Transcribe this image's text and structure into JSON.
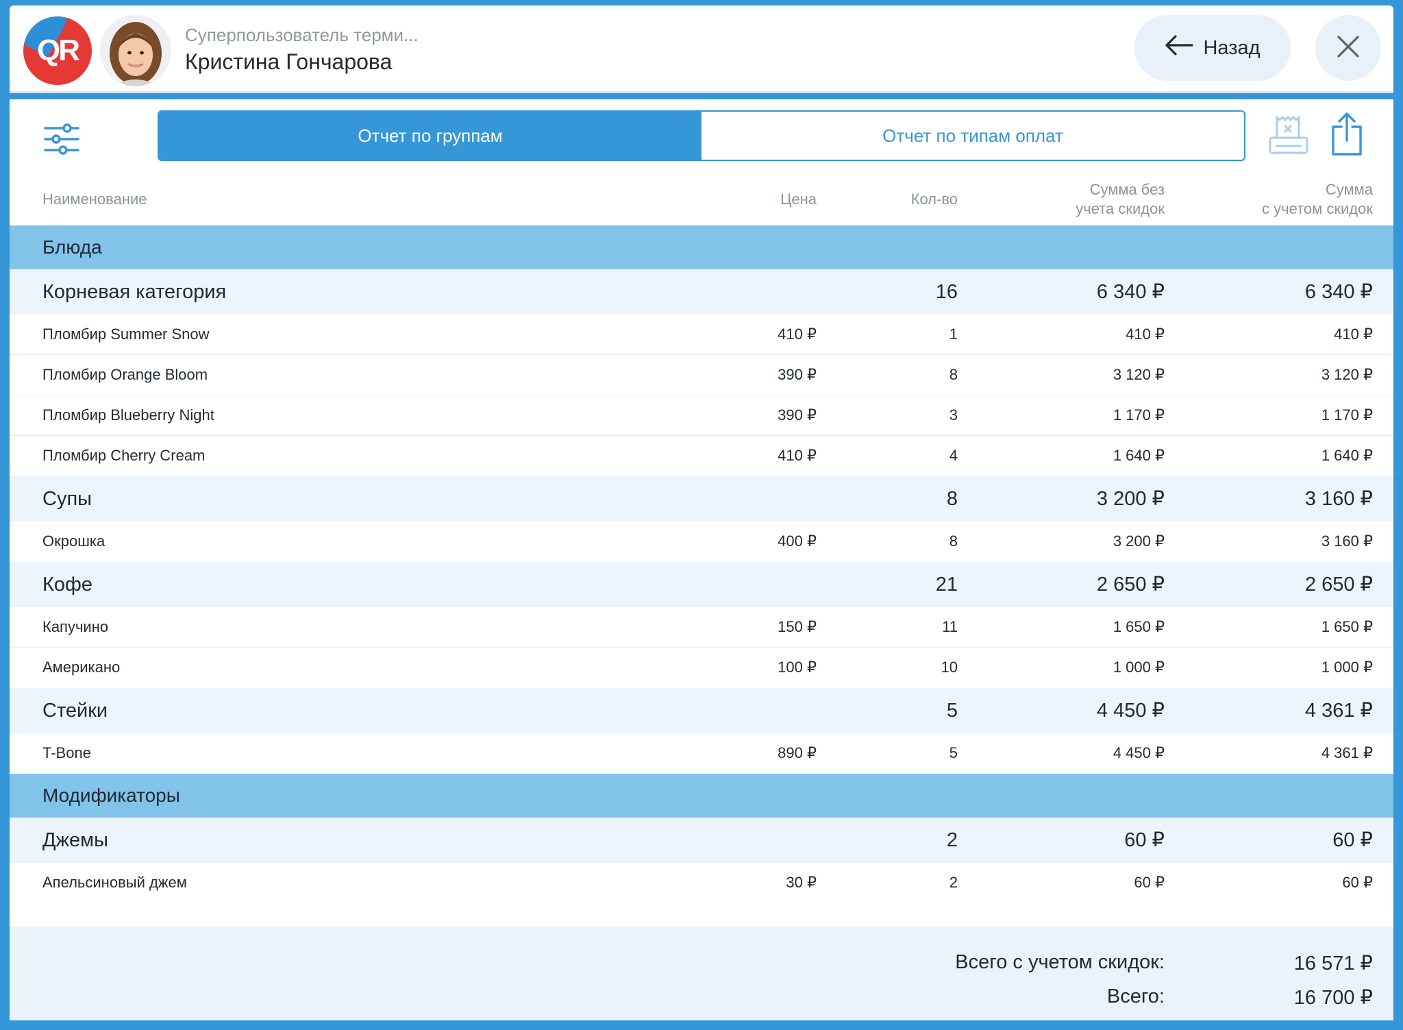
{
  "header": {
    "logo_text": "QR",
    "user_role": "Суперпользователь терми...",
    "user_name": "Кристина Гончарова",
    "back_label": "Назад"
  },
  "tabs": [
    {
      "label": "Отчет по группам",
      "active": true
    },
    {
      "label": "Отчет по типам оплат",
      "active": false
    }
  ],
  "columns": {
    "name": "Наименование",
    "price": "Цена",
    "qty": "Кол-во",
    "sum_line1": "Сумма без",
    "sum_line2": "учета скидок",
    "disc_line1": "Сумма",
    "disc_line2": "с учетом скидок"
  },
  "rows": [
    {
      "type": "section",
      "name": "Блюда"
    },
    {
      "type": "group",
      "name": "Корневая категория",
      "qty": "16",
      "sum": "6 340 ₽",
      "disc": "6 340 ₽"
    },
    {
      "type": "item",
      "name": "Пломбир Summer Snow",
      "price": "410 ₽",
      "qty": "1",
      "sum": "410 ₽",
      "disc": "410 ₽"
    },
    {
      "type": "item",
      "name": "Пломбир Orange Bloom",
      "price": "390 ₽",
      "qty": "8",
      "sum": "3 120 ₽",
      "disc": "3 120 ₽"
    },
    {
      "type": "item",
      "name": "Пломбир Blueberry Night",
      "price": "390 ₽",
      "qty": "3",
      "sum": "1 170 ₽",
      "disc": "1 170 ₽"
    },
    {
      "type": "item",
      "name": "Пломбир Cherry Cream",
      "price": "410 ₽",
      "qty": "4",
      "sum": "1 640 ₽",
      "disc": "1 640 ₽"
    },
    {
      "type": "group",
      "name": "Супы",
      "qty": "8",
      "sum": "3 200 ₽",
      "disc": "3 160 ₽"
    },
    {
      "type": "item",
      "name": "Окрошка",
      "price": "400 ₽",
      "qty": "8",
      "sum": "3 200 ₽",
      "disc": "3 160 ₽"
    },
    {
      "type": "group",
      "name": "Кофе",
      "qty": "21",
      "sum": "2 650 ₽",
      "disc": "2 650 ₽"
    },
    {
      "type": "item",
      "name": "Капучино",
      "price": "150 ₽",
      "qty": "11",
      "sum": "1 650 ₽",
      "disc": "1 650 ₽"
    },
    {
      "type": "item",
      "name": "Американо",
      "price": "100 ₽",
      "qty": "10",
      "sum": "1 000 ₽",
      "disc": "1 000 ₽"
    },
    {
      "type": "group",
      "name": "Стейки",
      "qty": "5",
      "sum": "4 450 ₽",
      "disc": "4 361 ₽"
    },
    {
      "type": "item",
      "name": "T-Bone",
      "price": "890 ₽",
      "qty": "5",
      "sum": "4 450 ₽",
      "disc": "4 361 ₽"
    },
    {
      "type": "section",
      "name": "Модификаторы"
    },
    {
      "type": "group",
      "name": "Джемы",
      "qty": "2",
      "sum": "60 ₽",
      "disc": "60 ₽"
    },
    {
      "type": "item",
      "name": "Апельсиновый джем",
      "price": "30 ₽",
      "qty": "2",
      "sum": "60 ₽",
      "disc": "60 ₽"
    }
  ],
  "totals": {
    "discounted_label": "Всего с учетом скидок:",
    "discounted_value": "16 571 ₽",
    "total_label": "Всего:",
    "total_value": "16 700 ₽"
  },
  "colors": {
    "accent": "#3596d8",
    "section_bg": "#82c3e9",
    "group_bg": "#ecf4fc",
    "logo_red": "#e53935"
  },
  "icons": [
    "filter-sliders-icon",
    "receipt-printer-icon",
    "share-icon",
    "arrow-left-icon",
    "close-icon"
  ]
}
